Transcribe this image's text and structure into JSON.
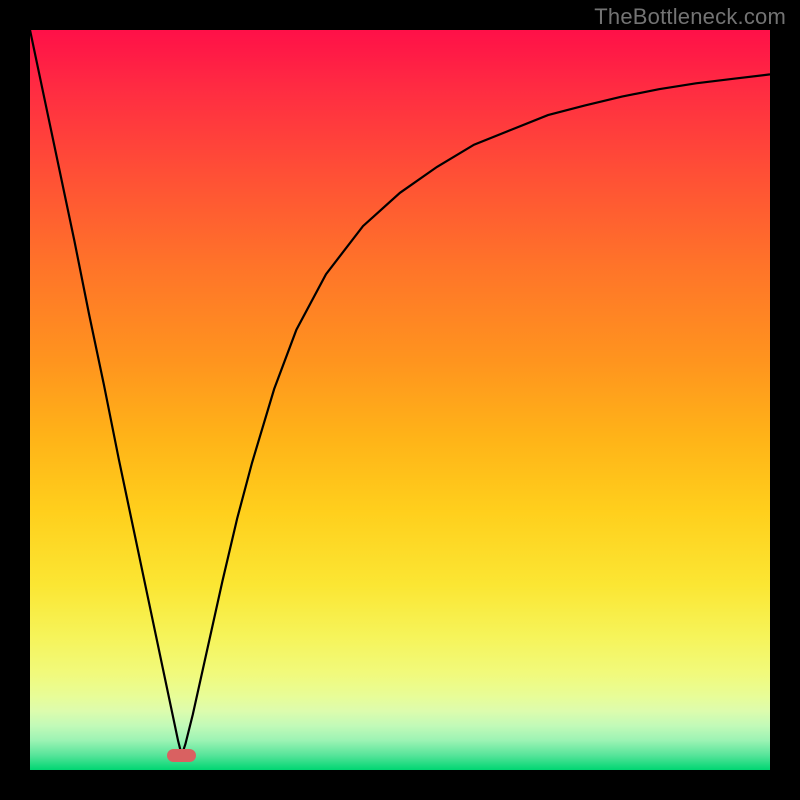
{
  "watermark": "TheBottleneck.com",
  "chart_data": {
    "type": "line",
    "x": [
      0.0,
      0.02,
      0.04,
      0.06,
      0.08,
      0.1,
      0.12,
      0.14,
      0.16,
      0.18,
      0.2,
      0.205,
      0.21,
      0.22,
      0.24,
      0.26,
      0.28,
      0.3,
      0.33,
      0.36,
      0.4,
      0.45,
      0.5,
      0.55,
      0.6,
      0.65,
      0.7,
      0.75,
      0.8,
      0.85,
      0.9,
      0.95,
      1.0
    ],
    "values": [
      1.0,
      0.905,
      0.81,
      0.715,
      0.615,
      0.52,
      0.42,
      0.325,
      0.23,
      0.135,
      0.04,
      0.02,
      0.035,
      0.075,
      0.165,
      0.255,
      0.34,
      0.415,
      0.515,
      0.595,
      0.67,
      0.735,
      0.78,
      0.815,
      0.845,
      0.865,
      0.885,
      0.898,
      0.91,
      0.92,
      0.928,
      0.934,
      0.94
    ],
    "title": "",
    "xlabel": "",
    "ylabel": "",
    "xlim": [
      0,
      1
    ],
    "ylim": [
      0,
      1
    ],
    "marker": {
      "x": 0.205,
      "y": 0.02,
      "width_frac": 0.04,
      "height_frac": 0.018
    },
    "colors": {
      "curve": "#000000",
      "marker": "#d96161",
      "gradient_top": "#ff1048",
      "gradient_bottom": "#00d672",
      "frame": "#000000"
    }
  }
}
